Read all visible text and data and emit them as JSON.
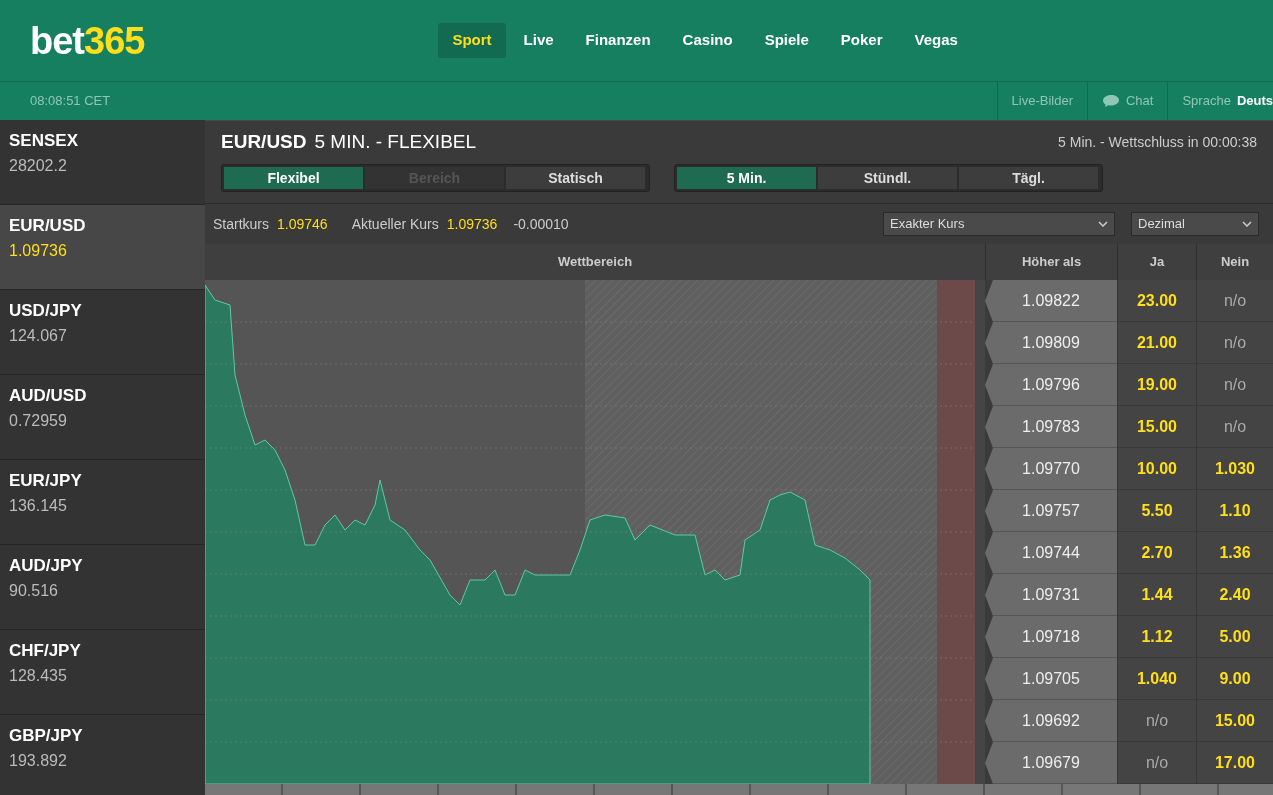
{
  "header": {
    "logo": {
      "part_1": "bet",
      "part_2": "365"
    },
    "nav": [
      {
        "label": "Sport",
        "selected": true
      },
      {
        "label": "Live",
        "selected": false
      },
      {
        "label": "Finanzen",
        "selected": false
      },
      {
        "label": "Casino",
        "selected": false
      },
      {
        "label": "Spiele",
        "selected": false
      },
      {
        "label": "Poker",
        "selected": false
      },
      {
        "label": "Vegas",
        "selected": false
      }
    ]
  },
  "subbar": {
    "time": "08:08:51 CET",
    "links": [
      "Live-Bilder",
      "Chat"
    ],
    "language_label": "Sprache",
    "language": "Deuts"
  },
  "sidebar": {
    "items": [
      {
        "name": "SENSEX",
        "value": "28202.2",
        "selected": false
      },
      {
        "name": "EUR/USD",
        "value": "1.09736",
        "selected": true
      },
      {
        "name": "USD/JPY",
        "value": "124.067",
        "selected": false
      },
      {
        "name": "AUD/USD",
        "value": "0.72959",
        "selected": false
      },
      {
        "name": "EUR/JPY",
        "value": "136.145",
        "selected": false
      },
      {
        "name": "AUD/JPY",
        "value": "90.516",
        "selected": false
      },
      {
        "name": "CHF/JPY",
        "value": "128.435",
        "selected": false
      },
      {
        "name": "GBP/JPY",
        "value": "193.892",
        "selected": false
      }
    ]
  },
  "market": {
    "pair": "EUR/USD",
    "title": "5 MIN. - FLEXIBEL",
    "countdown": "5 Min. - Wettschluss in 00:00:38",
    "mode_tabs": [
      {
        "label": "Flexibel",
        "selected": true,
        "disabled": false
      },
      {
        "label": "Bereich",
        "selected": false,
        "disabled": true
      },
      {
        "label": "Statisch",
        "selected": false,
        "disabled": false
      }
    ],
    "period_tabs": [
      {
        "label": "5 Min.",
        "selected": true
      },
      {
        "label": "Stündl.",
        "selected": false
      },
      {
        "label": "Tägl.",
        "selected": false
      }
    ],
    "start_label": "Startkurs",
    "start_value": "1.09746",
    "current_label": "Aktueller Kurs",
    "current_value": "1.09736",
    "change": "-0.00010",
    "price_type": "Exakter Kurs",
    "odds_format": "Dezimal"
  },
  "table": {
    "columns": [
      "Wettbereich",
      "Höher als",
      "Ja",
      "Nein"
    ],
    "rows": [
      {
        "strike": "1.09822",
        "yes": {
          "odds": "23.00",
          "available": true
        },
        "no": {
          "odds": "n/o",
          "available": false
        }
      },
      {
        "strike": "1.09809",
        "yes": {
          "odds": "21.00",
          "available": true
        },
        "no": {
          "odds": "n/o",
          "available": false
        }
      },
      {
        "strike": "1.09796",
        "yes": {
          "odds": "19.00",
          "available": true
        },
        "no": {
          "odds": "n/o",
          "available": false
        }
      },
      {
        "strike": "1.09783",
        "yes": {
          "odds": "15.00",
          "available": true
        },
        "no": {
          "odds": "n/o",
          "available": false
        }
      },
      {
        "strike": "1.09770",
        "yes": {
          "odds": "10.00",
          "available": true
        },
        "no": {
          "odds": "1.030",
          "available": true
        }
      },
      {
        "strike": "1.09757",
        "yes": {
          "odds": "5.50",
          "available": true
        },
        "no": {
          "odds": "1.10",
          "available": true
        }
      },
      {
        "strike": "1.09744",
        "yes": {
          "odds": "2.70",
          "available": true
        },
        "no": {
          "odds": "1.36",
          "available": true
        }
      },
      {
        "strike": "1.09731",
        "yes": {
          "odds": "1.44",
          "available": true
        },
        "no": {
          "odds": "2.40",
          "available": true
        }
      },
      {
        "strike": "1.09718",
        "yes": {
          "odds": "1.12",
          "available": true
        },
        "no": {
          "odds": "5.00",
          "available": true
        }
      },
      {
        "strike": "1.09705",
        "yes": {
          "odds": "1.040",
          "available": true
        },
        "no": {
          "odds": "9.00",
          "available": true
        }
      },
      {
        "strike": "1.09692",
        "yes": {
          "odds": "n/o",
          "available": false
        },
        "no": {
          "odds": "15.00",
          "available": true
        }
      },
      {
        "strike": "1.09679",
        "yes": {
          "odds": "n/o",
          "available": false
        },
        "no": {
          "odds": "17.00",
          "available": true
        }
      }
    ]
  }
}
